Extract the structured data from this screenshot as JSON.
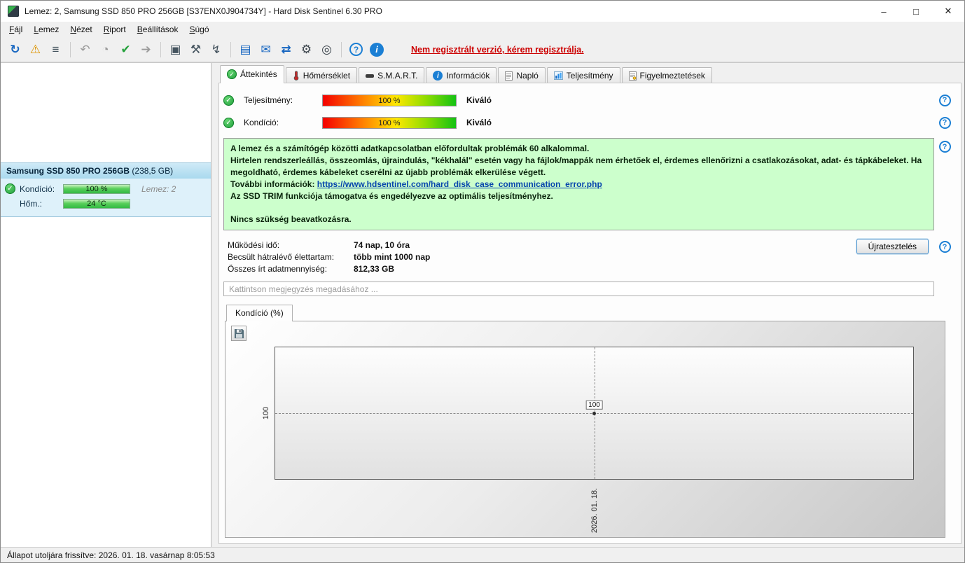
{
  "window": {
    "title": "Lemez: 2, Samsung SSD 850 PRO 256GB [S37ENX0J904734Y]  -  Hard Disk Sentinel 6.30 PRO",
    "controls": {
      "minimize": "–",
      "maximize": "□",
      "close": "✕"
    }
  },
  "colors": {
    "accent_blue": "#1b7fd4",
    "alert_red": "#cc0000",
    "ok_green": "#21a73d",
    "info_box_bg": "#ccffcc"
  },
  "menu": {
    "items": [
      {
        "label": "Fájl"
      },
      {
        "label": "Lemez"
      },
      {
        "label": "Nézet"
      },
      {
        "label": "Riport"
      },
      {
        "label": "Beállítások"
      },
      {
        "label": "Súgó"
      }
    ]
  },
  "toolbar": {
    "register_notice": "Nem regisztrált verzió, kérem regisztrálja.",
    "icons": [
      {
        "name": "refresh-icon",
        "glyph": "↻"
      },
      {
        "name": "surface-test-warning-icon",
        "glyph": "⚠"
      },
      {
        "name": "disk-details-icon",
        "glyph": "≡"
      },
      {
        "name": "undo-icon",
        "glyph": "↶"
      },
      {
        "name": "scheduler-icon",
        "glyph": "◔"
      },
      {
        "name": "accept-icon",
        "glyph": "✔"
      },
      {
        "name": "export-icon",
        "glyph": "➔"
      },
      {
        "name": "duplicate-icon",
        "glyph": "▣"
      },
      {
        "name": "tools-icon",
        "glyph": "⚒"
      },
      {
        "name": "connection-icon",
        "glyph": "↯"
      },
      {
        "name": "report-icon",
        "glyph": "▤"
      },
      {
        "name": "email-icon",
        "glyph": "✉"
      },
      {
        "name": "network-icon",
        "glyph": "⇄"
      },
      {
        "name": "settings-gear-icon",
        "glyph": "⚙"
      },
      {
        "name": "online-icon",
        "glyph": "◎"
      },
      {
        "name": "help-icon",
        "glyph": "?"
      },
      {
        "name": "info-icon",
        "glyph": "i"
      }
    ]
  },
  "sidebar": {
    "disk": {
      "name": "Samsung SSD 850 PRO 256GB",
      "size": " (238,5 GB)",
      "condition_label": "Kondíció:",
      "condition_value": "100 %",
      "temperature_label": "Hőm.:",
      "temperature_value": "24 °C",
      "disk_number": "Lemez: 2"
    }
  },
  "tabs": {
    "items": [
      {
        "label": "Áttekintés"
      },
      {
        "label": "Hőmérséklet"
      },
      {
        "label": "S.M.A.R.T."
      },
      {
        "label": "Információk"
      },
      {
        "label": "Napló"
      },
      {
        "label": "Teljesítmény"
      },
      {
        "label": "Figyelmeztetések"
      }
    ]
  },
  "overview": {
    "performance": {
      "label": "Teljesítmény:",
      "value": "100 %",
      "rating": "Kiváló"
    },
    "condition": {
      "label": "Kondíció:",
      "value": "100 %",
      "rating": "Kiváló"
    },
    "info_box": {
      "line1": "A lemez és a számítógép közötti adatkapcsolatban előfordultak problémák 60 alkalommal.",
      "line2": "Hirtelen rendszerleállás, összeomlás, újraindulás, \"kékhalál\" esetén vagy ha fájlok/mappák nem érhetőek el, érdemes ellenőrizni a csatlakozásokat, adat- és tápkábeleket. Ha megoldható, érdemes kábeleket cserélni az újabb problémák elkerülése végett.",
      "more_info_label": "További információk: ",
      "link": "https://www.hdsentinel.com/hard_disk_case_communication_error.php",
      "trim_line": "Az SSD TRIM funkciója támogatva és engedélyezve az optimális teljesítményhez.",
      "action_line": "Nincs szükség beavatkozásra."
    },
    "stats": [
      {
        "label": "Működési idő:",
        "value": "74 nap, 10 óra"
      },
      {
        "label": "Becsült hátralévő élettartam:",
        "value": "több mint 1000 nap"
      },
      {
        "label": "Összes írt adatmennyiség:",
        "value": "812,33 GB"
      }
    ],
    "retest_button": "Újratesztelés",
    "comment_placeholder": "Kattintson megjegyzés megadásához ..."
  },
  "chart": {
    "tab_label": "Kondíció  (%)",
    "y_tick": "100",
    "point_label": "100",
    "x_tick": "2026. 01. 18."
  },
  "chart_data": {
    "type": "line",
    "title": "Kondíció (%)",
    "x": [
      "2026. 01. 18."
    ],
    "series": [
      {
        "name": "Kondíció",
        "values": [
          100
        ]
      }
    ],
    "y_ticks": [
      100
    ],
    "ylim": [
      0,
      100
    ],
    "grid": "dashed-crosshair",
    "legend": "none"
  },
  "statusbar": {
    "text": "Állapot utoljára frissítve: 2026. 01. 18. vasárnap 8:05:53"
  }
}
